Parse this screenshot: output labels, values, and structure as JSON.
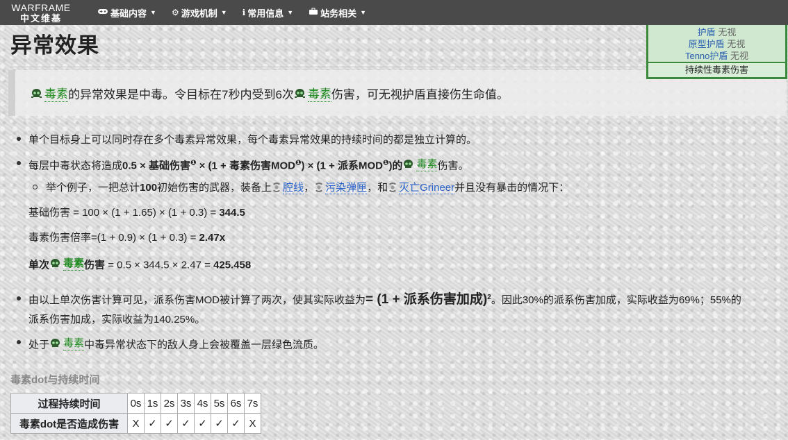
{
  "nav": {
    "logo_en": "WARFRAME",
    "logo_cn": "中文维基",
    "items": [
      {
        "label": "基础内容",
        "icon": "gamepad-icon"
      },
      {
        "label": "游戏机制",
        "icon": "gear-icon"
      },
      {
        "label": "常用信息",
        "icon": "info-icon"
      },
      {
        "label": "站务相关",
        "icon": "briefcase-icon"
      }
    ]
  },
  "infobox": {
    "rows": [
      {
        "label": "护盾",
        "value": "无视"
      },
      {
        "label": "原型护盾",
        "value": "无视"
      },
      {
        "label": "Tenno护盾",
        "value": "无视"
      }
    ],
    "footer": "持续性毒素伤害"
  },
  "page_title": "异常效果",
  "quote": {
    "toxin": "毒素",
    "text1": "的异常效果是中毒。令目标在7秒内受到6次",
    "text2": "伤害，可无视护盾直接伤生命值。"
  },
  "bullets": {
    "b1": "单个目标身上可以同时存在多个毒素异常效果，每个毒素异常效果的持续时间的都是独立计算的。",
    "b2_pre": "每层中毒状态将造成",
    "b2_formula_a": "0.5 × 基础伤害",
    "b2_formula_b": " × (1 + 毒素伤害MOD",
    "b2_formula_c": ") × (1 + 派系MOD",
    "b2_formula_d": ")的",
    "b2_post": "伤害。",
    "sup_mark": "❶",
    "sub_pre": "举个例子，一把总计",
    "sub_num": "100",
    "sub_mid": "初始伤害的武器，装备上",
    "mod1": "腔线",
    "mod2": "污染弹匣",
    "sub_and": "，和",
    "mod3": "灭亡Grineer",
    "sub_end": "并且没有暴击的情况下：",
    "calc1_text": "基础伤害 = 100 × (1 + 1.65) × (1 + 0.3) = ",
    "calc1_value": "344.5",
    "calc2_text": "毒素伤害倍率=(1 + 0.9) × (1 + 0.3) = ",
    "calc2_value": "2.47x",
    "calc3_pre": "单次",
    "calc3_post": "伤害",
    "calc3_text": " = 0.5 × 344.5 × 2.47 = ",
    "calc3_value": "425.458",
    "b3_pre": "由以上单次伤害计算可见，派系伤害MOD被计算了两次，使其实际收益为",
    "b3_formula": "= (1 + 派系伤害加成)",
    "b3_sq": "2",
    "b3_post": "。因此30%的派系伤害加成，实际收益为69%；55%的",
    "b3_line2": "派系伤害加成，实际收益为140.25%。",
    "b4_pre": "处于",
    "b4_post": "中毒异常状态下的敌人身上会被覆盖一层绿色流质。"
  },
  "section_title": "毒素dot与持续时间",
  "table": {
    "row1_header": "过程持续时间",
    "row1": [
      "0s",
      "1s",
      "2s",
      "3s",
      "4s",
      "5s",
      "6s",
      "7s"
    ],
    "row2_header": "毒素dot是否造成伤害",
    "row2": [
      "X",
      "✓",
      "✓",
      "✓",
      "✓",
      "✓",
      "✓",
      "X"
    ]
  }
}
